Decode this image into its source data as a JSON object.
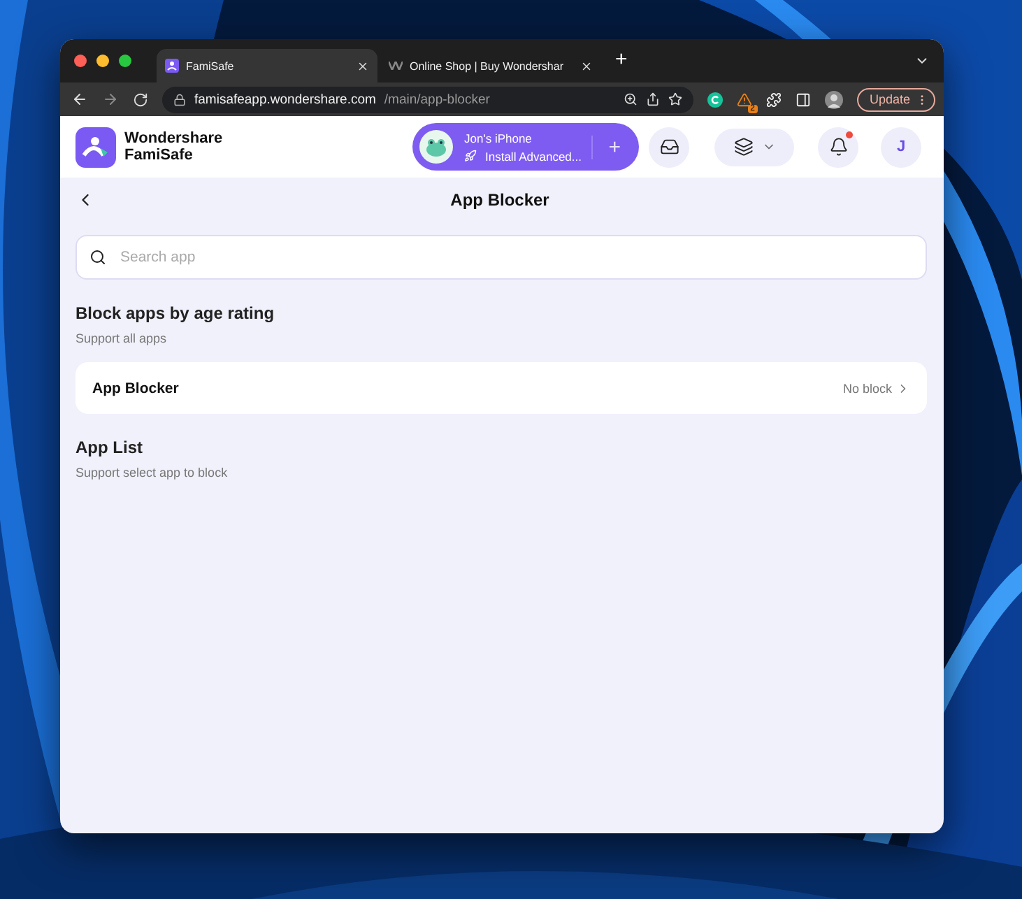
{
  "browser": {
    "tabs": [
      {
        "title": "FamiSafe",
        "selected": true
      },
      {
        "title": "Online Shop | Buy Wondershar",
        "selected": false
      }
    ],
    "new_tab": "+",
    "address": {
      "host": "famisafeapp.wondershare.com",
      "path": "/main/app-blocker"
    },
    "extension_badge": "2",
    "update_button": "Update"
  },
  "header": {
    "brand": [
      "Wondershare",
      "FamiSafe"
    ],
    "device": {
      "name": "Jon's iPhone",
      "action": "Install Advanced...",
      "add": "+"
    },
    "notification_dot": true,
    "avatar": "J"
  },
  "page": {
    "title": "App Blocker",
    "search": {
      "placeholder": "Search app"
    },
    "sections": [
      {
        "title": "Block apps by age rating",
        "subtitle": "Support all apps",
        "rows": [
          {
            "label": "App Blocker",
            "value": "No block"
          }
        ]
      },
      {
        "title": "App List",
        "subtitle": "Support select app to block"
      }
    ]
  }
}
